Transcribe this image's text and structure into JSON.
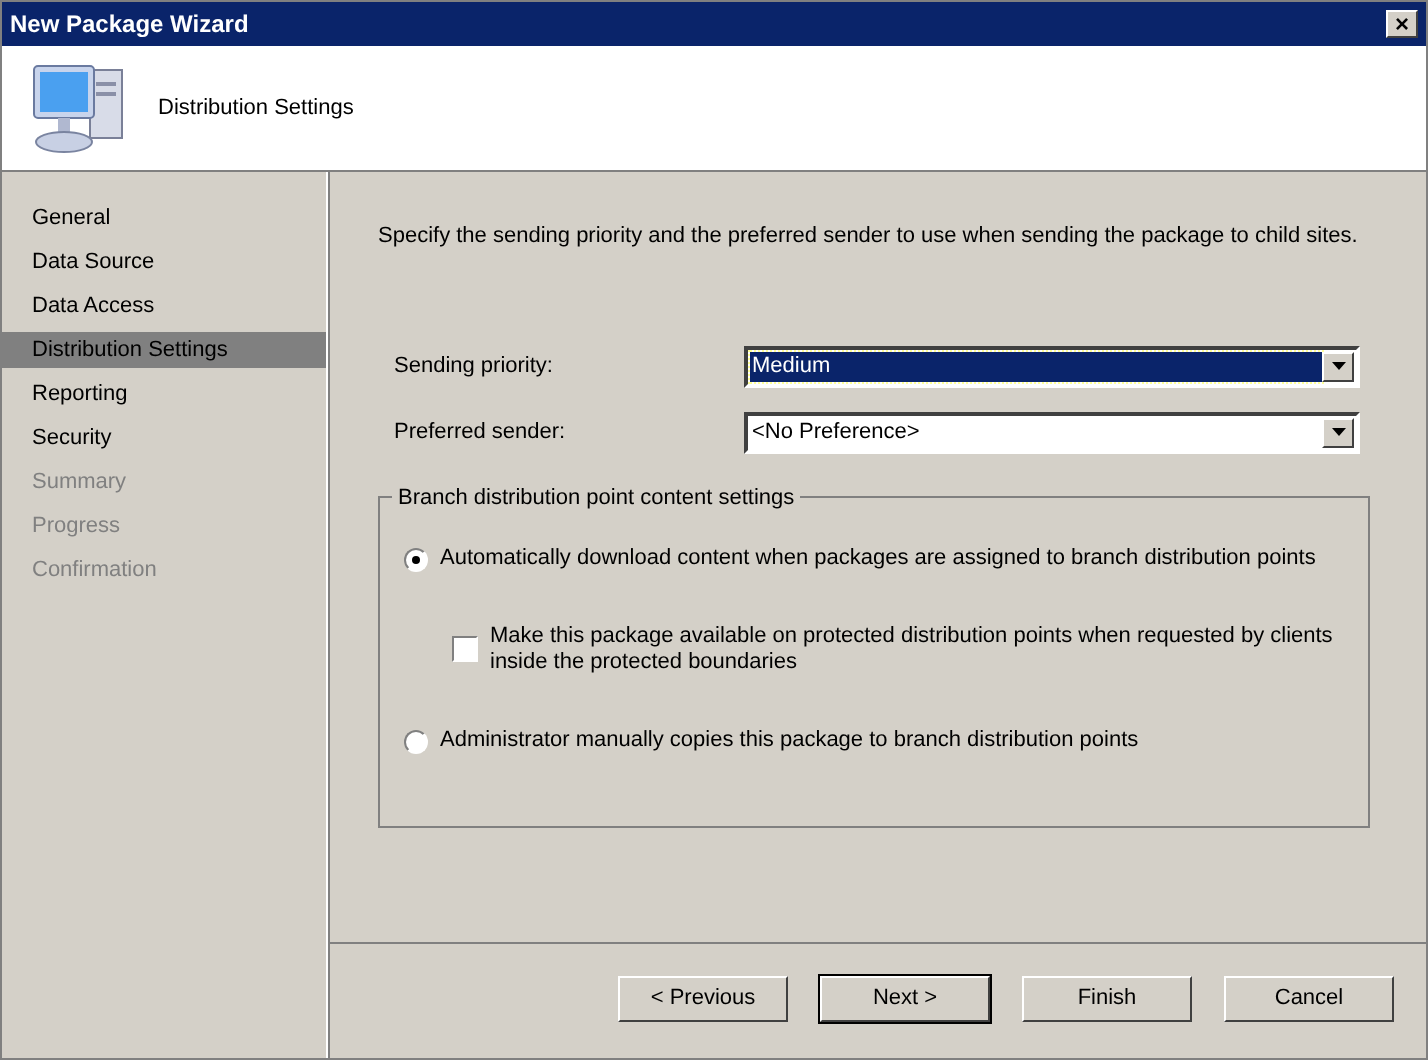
{
  "window": {
    "title": "New Package Wizard",
    "close": "×"
  },
  "header": {
    "title": "Distribution Settings"
  },
  "sidebar": {
    "items": [
      {
        "label": "General",
        "selected": false,
        "disabled": false
      },
      {
        "label": "Data Source",
        "selected": false,
        "disabled": false
      },
      {
        "label": "Data Access",
        "selected": false,
        "disabled": false
      },
      {
        "label": "Distribution Settings",
        "selected": true,
        "disabled": false
      },
      {
        "label": "Reporting",
        "selected": false,
        "disabled": false
      },
      {
        "label": "Security",
        "selected": false,
        "disabled": false
      },
      {
        "label": "Summary",
        "selected": false,
        "disabled": true
      },
      {
        "label": "Progress",
        "selected": false,
        "disabled": true
      },
      {
        "label": "Confirmation",
        "selected": false,
        "disabled": true
      }
    ]
  },
  "instructions": "Specify the sending priority and the preferred sender to use when sending the package to child sites.",
  "fields": [
    {
      "label": "Sending priority:",
      "value": "Medium",
      "focused": true
    },
    {
      "label": "Preferred sender:",
      "value": "<No Preference>",
      "focused": false
    }
  ],
  "group": {
    "title": "Branch distribution point content settings",
    "options": [
      {
        "kind": "radio",
        "label": "Automatically download content when packages are assigned to branch distribution points",
        "selected": true
      },
      {
        "kind": "checkbox",
        "label": "Make this package available on protected distribution points when requested by clients inside the protected boundaries",
        "checked": false
      },
      {
        "kind": "radio",
        "label": "Administrator manually copies this package to branch distribution points",
        "selected": false
      }
    ]
  },
  "buttons": [
    {
      "label": "< Previous",
      "default": false
    },
    {
      "label": "Next >",
      "default": true
    },
    {
      "label": "Finish",
      "default": false
    },
    {
      "label": "Cancel",
      "default": false
    }
  ]
}
